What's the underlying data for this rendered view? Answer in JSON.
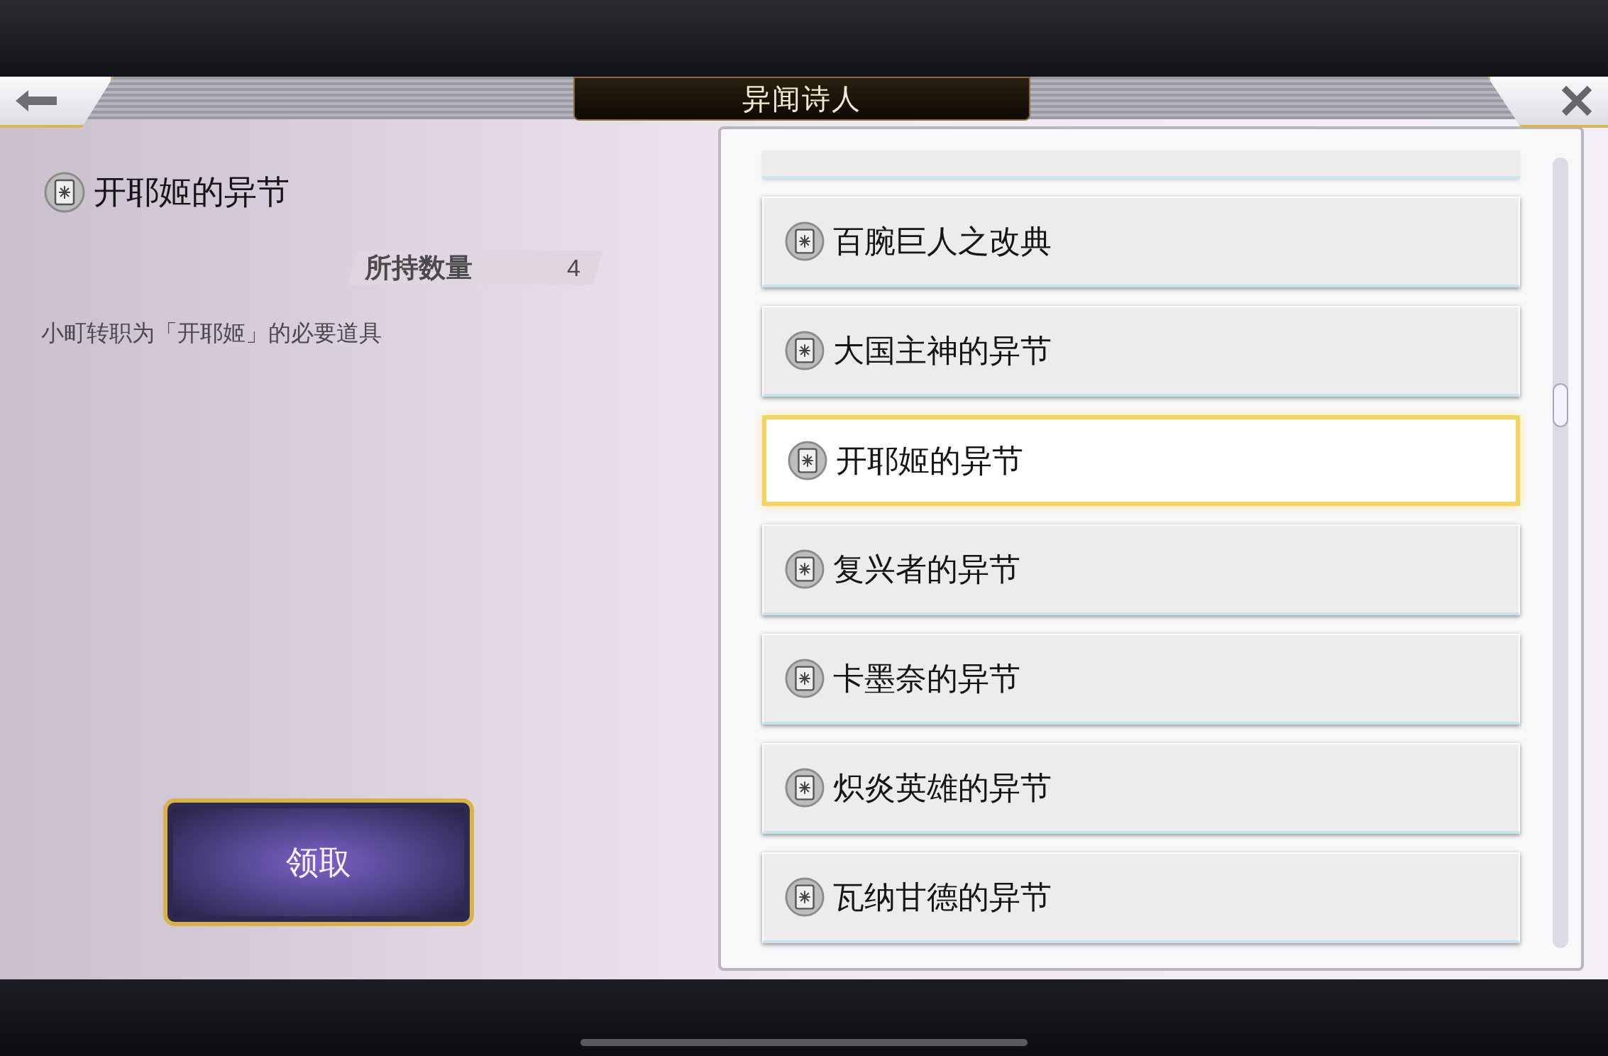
{
  "title": "异闻诗人",
  "detail": {
    "name": "开耶姬的异节",
    "quantity_label": "所持数量",
    "quantity": "4",
    "description": "小町转职为「开耶姬」的必要道具",
    "claim_button": "领取"
  },
  "items": [
    {
      "label": "百腕巨人之改典",
      "selected": false
    },
    {
      "label": "大国主神的异节",
      "selected": false
    },
    {
      "label": "开耶姬的异节",
      "selected": true
    },
    {
      "label": "复兴者的异节",
      "selected": false
    },
    {
      "label": "卡墨奈的异节",
      "selected": false
    },
    {
      "label": "炽炎英雄的异节",
      "selected": false
    },
    {
      "label": "瓦纳甘德的异节",
      "selected": false
    }
  ]
}
